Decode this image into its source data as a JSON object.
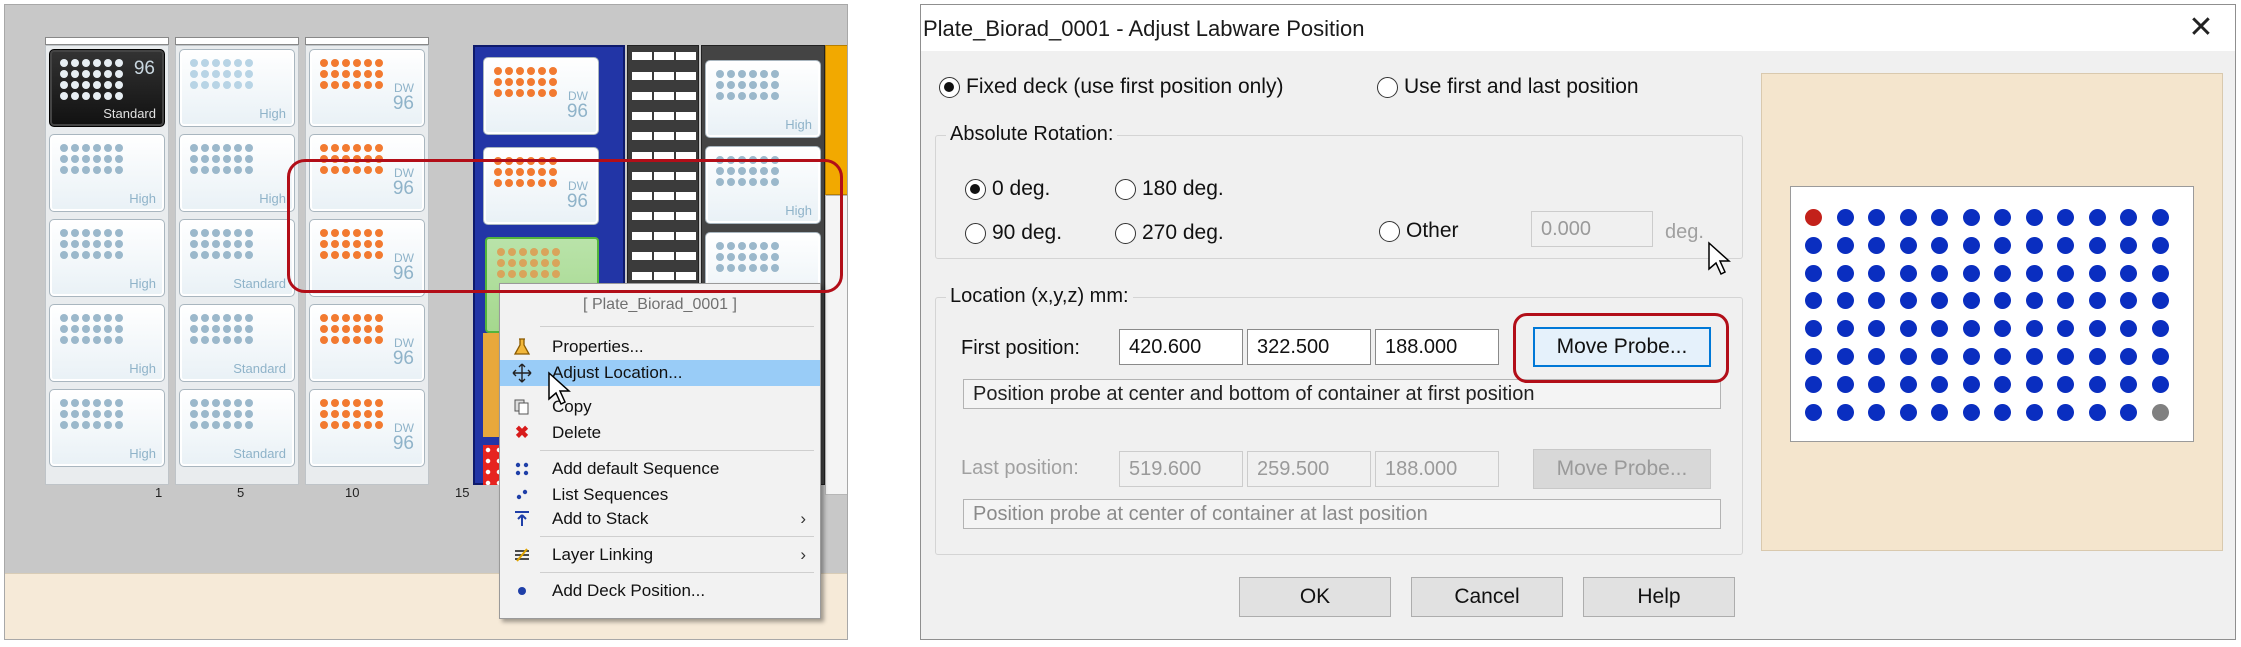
{
  "deck": {
    "tiles": {
      "standard_96": {
        "num": "96",
        "label": "Standard"
      },
      "high": "High",
      "standard": "Standard",
      "dw": {
        "top": "DW",
        "num": "96"
      }
    },
    "column_labels": [
      "1",
      "5",
      "10",
      "15"
    ]
  },
  "context_menu": {
    "header": "[ Plate_Biorad_0001 ]",
    "items": [
      {
        "label": "Properties...",
        "icon": "flask-icon"
      },
      {
        "label": "Adjust Location...",
        "icon": "move-arrows-icon"
      },
      {
        "label": "Copy",
        "icon": "copy-icon"
      },
      {
        "label": "Delete",
        "icon": "delete-x-icon"
      },
      {
        "label": "Add default Sequence",
        "icon": "sequence-dots-icon"
      },
      {
        "label": "List Sequences",
        "icon": "list-dots-icon"
      },
      {
        "label": "Add to Stack",
        "icon": "stack-up-icon"
      },
      {
        "label": "Layer Linking",
        "icon": "layer-link-icon"
      },
      {
        "label": "Add Deck Position...",
        "icon": "dot-icon"
      }
    ],
    "highlight_color": "#99ccf7"
  },
  "dialog": {
    "title": "Plate_Biorad_0001 - Adjust Labware Position",
    "close": "✕",
    "mode": {
      "fixed_label": "Fixed deck (use first position only)",
      "first_last_label": "Use first and last position",
      "selected": "fixed"
    },
    "rotation": {
      "legend": "Absolute Rotation:",
      "opt_0": "0 deg.",
      "opt_180": "180 deg.",
      "opt_90": "90 deg.",
      "opt_270": "270 deg.",
      "other": "Other",
      "other_value": "0.000",
      "unit": "deg.",
      "selected": "0 deg."
    },
    "location": {
      "legend": "Location (x,y,z) mm:",
      "first_label": "First position:",
      "first": {
        "x": "420.600",
        "y": "322.500",
        "z": "188.000"
      },
      "move_probe": "Move Probe...",
      "first_hint": "Position probe at center and bottom of container at first position",
      "last_label": "Last position:",
      "last": {
        "x": "519.600",
        "y": "259.500",
        "z": "188.000"
      },
      "last_hint": "Position probe at center of container at last position"
    },
    "buttons": {
      "ok": "OK",
      "cancel": "Cancel",
      "help": "Help"
    },
    "preview": {
      "rows": 8,
      "cols": 12,
      "well_color": "#0a2ec0",
      "first_well_color": "#c3211a",
      "last_well_color": "#808080"
    }
  },
  "colors": {
    "highlight_box": "#b20e18",
    "accent_blue": "#0078d7"
  }
}
